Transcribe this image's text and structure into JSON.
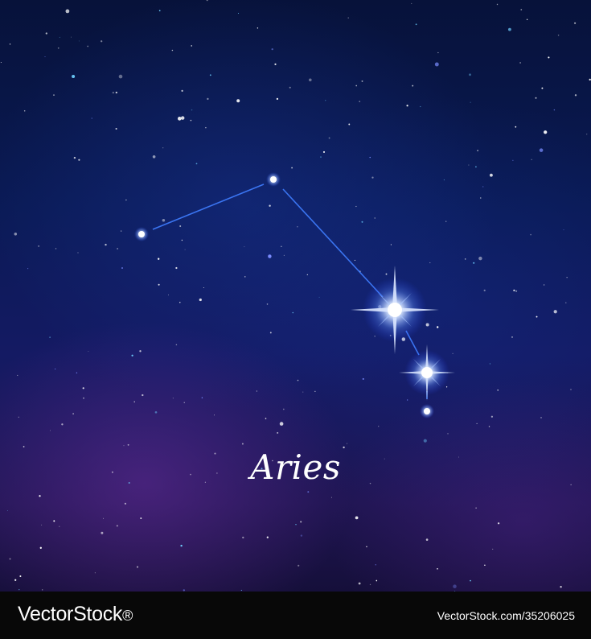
{
  "caption": "Aries",
  "watermark": {
    "brand": "VectorStock",
    "brand_suffix": "®",
    "image_ref": "VectorStock.com/35206025"
  },
  "colors": {
    "sky_top": "#07123a",
    "sky_bottom": "#150f3a",
    "constellation_line": "#3f7dff",
    "star_glow": "#8fb6ff",
    "footer": "#080808"
  }
}
